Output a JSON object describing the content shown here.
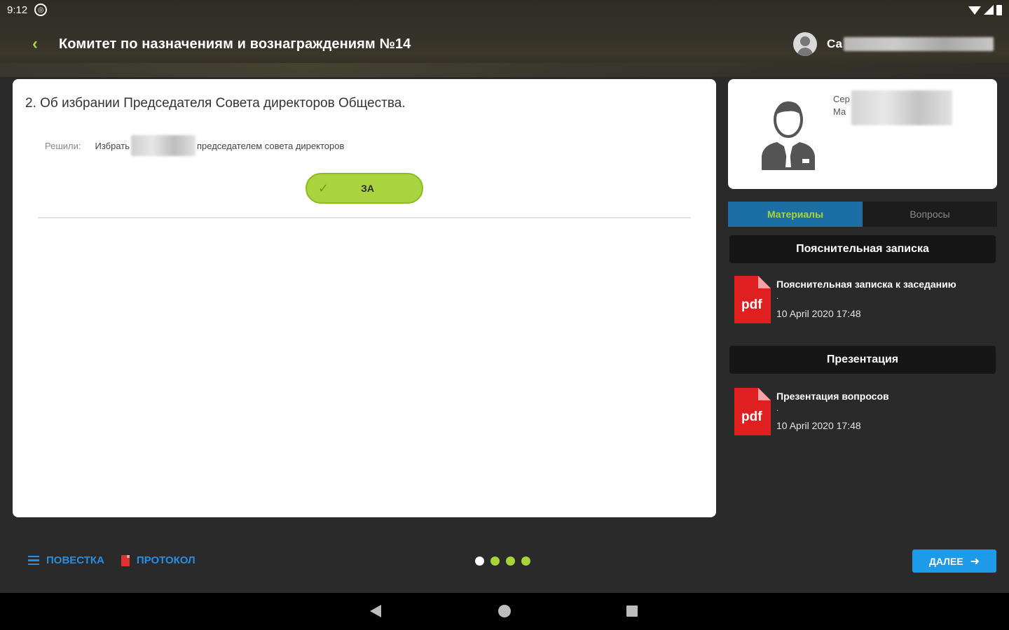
{
  "status_bar": {
    "time": "9:12",
    "sync_icon": "sync-circle-icon"
  },
  "header": {
    "title": "Комитет по назначениям и вознаграждениям №14",
    "user_name_visible": "Са",
    "back_icon": "chevron-left-icon"
  },
  "question": {
    "title": "2. Об избрании Председателя Совета директоров Общества.",
    "decision_label": "Решили:",
    "decision_prefix": "Избрать",
    "decision_suffix": "председателем совета директоров",
    "vote_label": "ЗА"
  },
  "person": {
    "line1": "Сер",
    "line2": "Ма"
  },
  "tabs": [
    {
      "label": "Материалы",
      "active": true
    },
    {
      "label": "Вопросы",
      "active": false
    }
  ],
  "materials": [
    {
      "section": "Пояснительная записка",
      "doc_title": "Пояснительная записка к заседанию",
      "doc_dot": ".",
      "doc_date": "10 April 2020 17:48",
      "icon_label": "pdf"
    },
    {
      "section": "Презентация",
      "doc_title": "Презентация вопросов",
      "doc_dot": ".",
      "doc_date": "10 April 2020 17:48",
      "icon_label": "pdf"
    }
  ],
  "bottom": {
    "agenda_label": "ПОВЕСТКА",
    "protocol_label": "ПРОТОКОЛ",
    "next_label": "ДАЛЕЕ",
    "pager_count": 4,
    "pager_active_index": 0
  },
  "colors": {
    "accent_green": "#a8d43a",
    "accent_blue": "#1e9be8",
    "tab_active_bg": "#1b6fa5",
    "pdf_red": "#e02020"
  }
}
